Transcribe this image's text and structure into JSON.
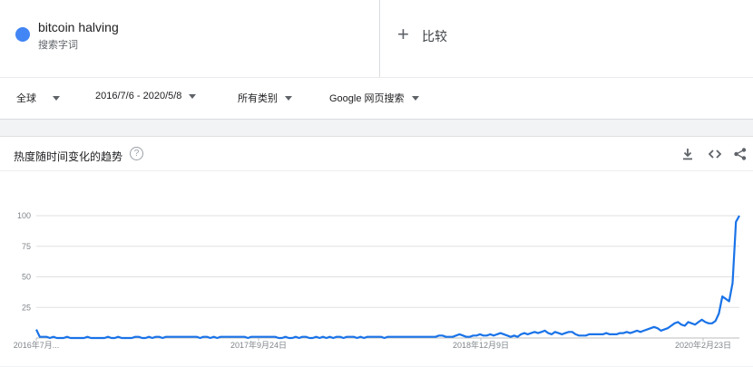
{
  "search_term": {
    "name": "bitcoin halving",
    "type": "搜索字词",
    "color": "#4285f4"
  },
  "compare": {
    "plus": "+",
    "label": "比较"
  },
  "filters": {
    "region": "全球",
    "date_range": "2016/7/6 - 2020/5/8",
    "category": "所有类别",
    "property": "Google 网页搜索"
  },
  "panel": {
    "title": "热度随时间变化的趋势",
    "help": "?"
  },
  "icons": [
    "help-icon",
    "download-icon",
    "embed-icon",
    "share-icon"
  ],
  "chart_data": {
    "type": "line",
    "title": "热度随时间变化的趋势",
    "xlabel": "",
    "ylabel": "",
    "ylim": [
      0,
      100
    ],
    "yticks": [
      "100",
      "75",
      "50",
      "25"
    ],
    "xticks": [
      "2016年7月...",
      "2017年9月24日",
      "2018年12月9日",
      "2020年2月23日"
    ],
    "grid": true,
    "series": [
      {
        "name": "bitcoin halving",
        "color": "#1a73e8",
        "values": [
          7,
          1,
          1,
          1,
          0,
          1,
          0,
          0,
          0,
          1,
          0,
          0,
          0,
          0,
          0,
          1,
          0,
          0,
          0,
          0,
          0,
          1,
          0,
          0,
          1,
          0,
          0,
          0,
          0,
          1,
          1,
          0,
          0,
          1,
          0,
          1,
          1,
          0,
          1,
          1,
          1,
          1,
          1,
          1,
          1,
          1,
          1,
          1,
          0,
          1,
          1,
          0,
          1,
          0,
          1,
          1,
          1,
          1,
          1,
          1,
          1,
          1,
          0,
          1,
          1,
          1,
          1,
          1,
          1,
          1,
          1,
          0,
          0,
          1,
          0,
          0,
          1,
          0,
          1,
          1,
          0,
          0,
          1,
          0,
          1,
          0,
          1,
          0,
          1,
          1,
          0,
          1,
          1,
          1,
          0,
          1,
          0,
          1,
          1,
          1,
          1,
          1,
          0,
          1,
          1,
          1,
          1,
          1,
          1,
          1,
          1,
          1,
          1,
          1,
          1,
          1,
          1,
          1,
          2,
          2,
          1,
          1,
          1,
          2,
          3,
          2,
          1,
          1,
          2,
          2,
          3,
          2,
          2,
          3,
          2,
          3,
          4,
          3,
          2,
          1,
          2,
          1,
          3,
          4,
          3,
          4,
          5,
          4,
          5,
          6,
          4,
          3,
          5,
          4,
          3,
          4,
          5,
          5,
          3,
          2,
          2,
          2,
          3,
          3,
          3,
          3,
          3,
          4,
          3,
          3,
          3,
          4,
          4,
          5,
          4,
          5,
          6,
          5,
          6,
          7,
          8,
          9,
          8,
          6,
          7,
          8,
          10,
          12,
          13,
          11,
          10,
          13,
          12,
          11,
          13,
          15,
          13,
          12,
          12,
          14,
          20,
          34,
          32,
          30,
          45,
          95,
          100
        ]
      }
    ]
  }
}
